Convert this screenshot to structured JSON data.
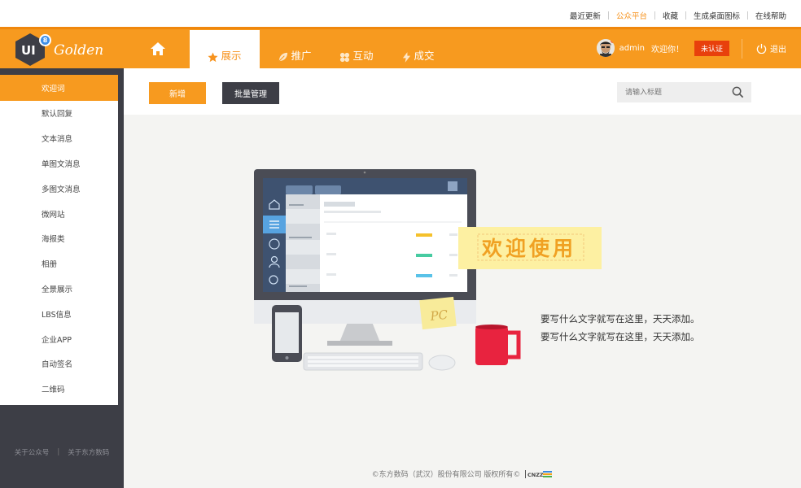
{
  "toplinks": [
    "最近更新",
    "公众平台",
    "收藏",
    "生成桌面图标",
    "在线帮助"
  ],
  "logo": {
    "badge": "8",
    "ui": "UI",
    "brand": "Golden"
  },
  "nav": {
    "tabs": [
      "展示",
      "推广",
      "互动",
      "成交"
    ]
  },
  "user": {
    "name": "admin",
    "welcome": "欢迎你！",
    "status": "未认证",
    "logout": "退出"
  },
  "sidebar": {
    "items": [
      "欢迎词",
      "默认回复",
      "文本消息",
      "单图文消息",
      "多图文消息",
      "微网站",
      "海报类",
      "相册",
      "全景展示",
      "LBS信息",
      "企业APP",
      "自动签名",
      "二维码"
    ],
    "footer": [
      "关于公众号",
      "关于东方数码"
    ]
  },
  "toolbar": {
    "add": "新增",
    "batch": "批量管理",
    "search_placeholder": "请输入标题"
  },
  "main": {
    "welcome": "欢迎使用",
    "pc": "PC",
    "lines": [
      "要写什么文字就写在这里，天天添加。",
      "要写什么文字就写在这里，天天添加。"
    ],
    "footer": "©东方数码（武汉）股份有限公司   版权所有©",
    "cnzz": "CNZZ"
  },
  "colors": {
    "accent": "#f79a1f",
    "dark": "#3d3e46",
    "badge": "#3d8ee8",
    "alert": "#e8400c"
  }
}
